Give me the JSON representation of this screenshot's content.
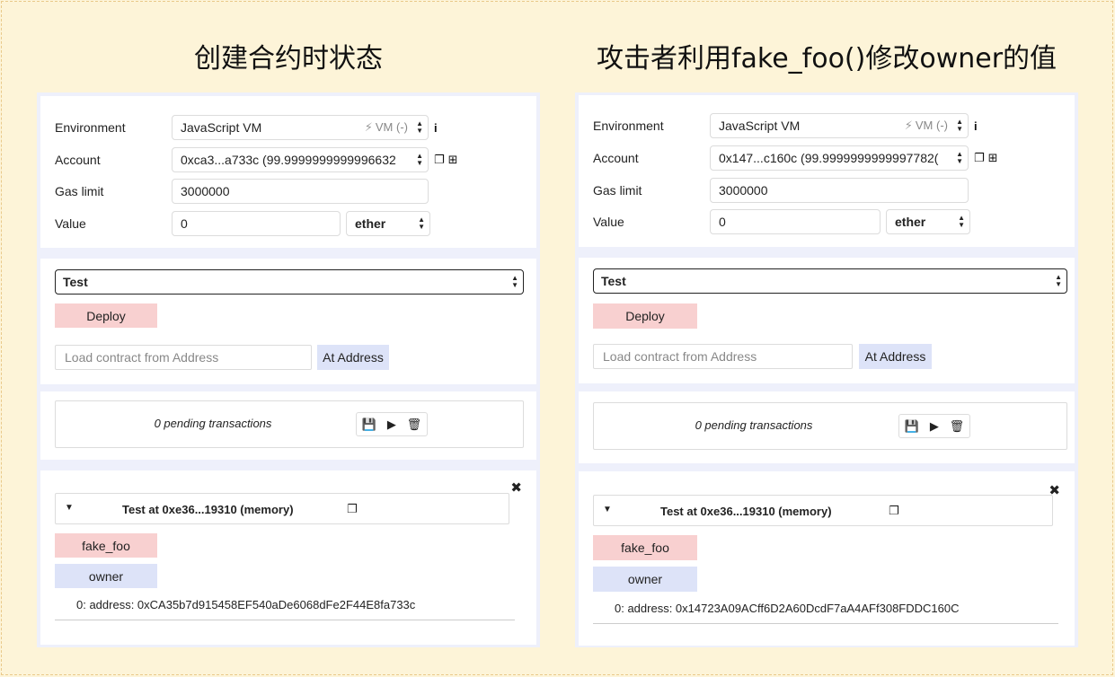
{
  "panels": [
    {
      "caption": "创建合约时状态",
      "labels": {
        "environment": "Environment",
        "account": "Account",
        "gas_limit": "Gas limit",
        "value": "Value"
      },
      "environment": {
        "value": "JavaScript VM",
        "vm_tag": "VM (-)",
        "info": "i"
      },
      "account": {
        "value": "0xca3...a733c (99.9999999999996632"
      },
      "gas_limit": "3000000",
      "value": {
        "amount": "0",
        "unit": "ether"
      },
      "contract_select": "Test",
      "deploy_label": "Deploy",
      "load_address_placeholder": "Load contract from Address",
      "at_address_label": "At Address",
      "pending": "0 pending transactions",
      "close": "✖",
      "instance_title": "Test at 0xe36...19310 (memory)",
      "functions": {
        "fake_foo": "fake_foo",
        "owner": "owner"
      },
      "result": "0: address: 0xCA35b7d915458EF540aDe6068dFe2F44E8fa733c"
    },
    {
      "caption": "攻击者利用fake_foo()修改owner的值",
      "labels": {
        "environment": "Environment",
        "account": "Account",
        "gas_limit": "Gas limit",
        "value": "Value"
      },
      "environment": {
        "value": "JavaScript VM",
        "vm_tag": "VM (-)",
        "info": "i"
      },
      "account": {
        "value": "0x147...c160c (99.9999999999997782("
      },
      "gas_limit": "3000000",
      "value": {
        "amount": "0",
        "unit": "ether"
      },
      "contract_select": "Test",
      "deploy_label": "Deploy",
      "load_address_placeholder": "Load contract from Address",
      "at_address_label": "At Address",
      "pending": "0 pending transactions",
      "close": "✖",
      "instance_title": "Test at 0xe36...19310 (memory)",
      "functions": {
        "fake_foo": "fake_foo",
        "owner": "owner"
      },
      "result": "0: address: 0x14723A09ACff6D2A60DcdF7aA4AFf308FDDC160C"
    }
  ],
  "colors": {
    "background": "#fdf4d8",
    "pink_button": "#f8d0d0",
    "blue_button": "#dde3f8",
    "panel": "#eef0fb"
  },
  "icons": [
    "plug-icon",
    "info-icon",
    "copy-icon",
    "add-icon",
    "save-icon",
    "play-icon",
    "trash-icon",
    "close-icon",
    "caret-down-icon"
  ]
}
